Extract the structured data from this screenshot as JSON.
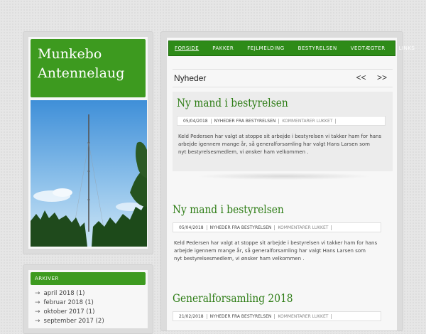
{
  "site": {
    "title_line1": "Munkebo",
    "title_line2": "Antennelaug"
  },
  "sidebar": {
    "archive_heading": "ARKIVER",
    "archive_items": [
      {
        "label": "april 2018",
        "count": "(1)"
      },
      {
        "label": "februar 2018",
        "count": "(1)"
      },
      {
        "label": "oktober 2017",
        "count": "(1)"
      },
      {
        "label": "september 2017",
        "count": "(2)"
      }
    ]
  },
  "nav": {
    "items": [
      "FORSIDE",
      "PAKKER",
      "FEJLMELDING",
      "BESTYRELSEN",
      "VEDTÆGTER",
      "LINKS"
    ]
  },
  "news": {
    "title": "Nyheder",
    "prev": "<<",
    "next": ">>"
  },
  "posts": [
    {
      "title": "Ny mand i bestyrelsen",
      "date": "05/04/2018",
      "category": "NYHEDER FRA BESTYRELSEN",
      "comments": "KOMMENTARER LUKKET",
      "body": [
        "Keld Pedersen har valgt at stoppe sit arbejde i bestyrelsen vi takker ham for hans",
        "arbejde igennem mange år, så generalforsamling har valgt Hans Larsen som",
        "nyt bestyrelsesmedlem, vi ønsker ham velkommen ."
      ]
    },
    {
      "title": "Ny mand i bestyrelsen",
      "date": "05/04/2018",
      "category": "NYHEDER FRA BESTYRELSEN",
      "comments": "KOMMENTARER LUKKET",
      "body": [
        "Keld Pedersen har valgt at stoppe sit arbejde i bestyrelsen vi takker ham for hans",
        "arbejde igennem mange år, så generalforsamling har valgt Hans Larsen som",
        "nyt bestyrelsesmedlem, vi ønsker ham velkommen ."
      ]
    },
    {
      "title": "Generalforsamling 2018",
      "date": "21/02/2018",
      "category": "NYHEDER FRA BESTYRELSEN",
      "comments": "KOMMENTARER LUKKET"
    }
  ],
  "colors": {
    "brand_green": "#3d9a1f",
    "title_green": "#2e7d16"
  }
}
